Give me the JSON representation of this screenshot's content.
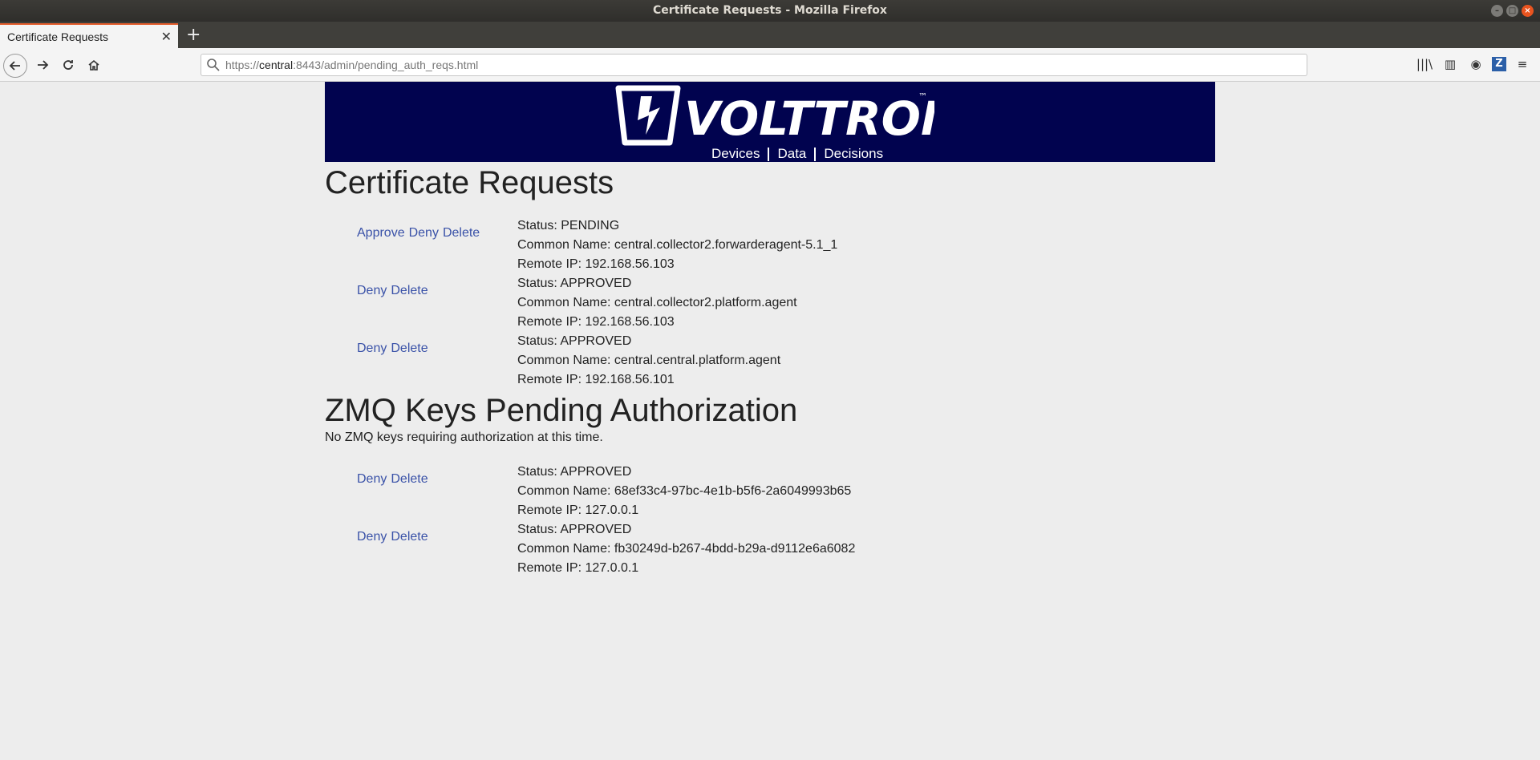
{
  "window": {
    "title": "Certificate Requests - Mozilla Firefox"
  },
  "tab": {
    "label": "Certificate Requests",
    "close": "✕",
    "new": "+"
  },
  "nav": {
    "url_prefix": "https://",
    "url_host": "central",
    "url_rest": ":8443/admin/pending_auth_reqs.html"
  },
  "banner": {
    "logo_text": "VOLTTRON",
    "logo_tm": "™",
    "links": [
      "Devices",
      "Data",
      "Decisions"
    ]
  },
  "certificates": {
    "title": "Certificate Requests",
    "requests": [
      {
        "actions": [
          "Approve",
          "Deny",
          "Delete"
        ],
        "status": "Status: PENDING",
        "common_name": "Common Name: central.collector2.forwarderagent-5.1_1",
        "remote_ip": "Remote IP: 192.168.56.103"
      },
      {
        "actions": [
          "Deny",
          "Delete"
        ],
        "status": "Status: APPROVED",
        "common_name": "Common Name: central.collector2.platform.agent",
        "remote_ip": "Remote IP: 192.168.56.103"
      },
      {
        "actions": [
          "Deny",
          "Delete"
        ],
        "status": "Status: APPROVED",
        "common_name": "Common Name: central.central.platform.agent",
        "remote_ip": "Remote IP: 192.168.56.101"
      }
    ]
  },
  "zmq": {
    "title": "ZMQ Keys Pending Authorization",
    "note": "No ZMQ keys requiring authorization at this time.",
    "keys": [
      {
        "actions": [
          "Deny",
          "Delete"
        ],
        "status": "Status: APPROVED",
        "common_name": "Common Name: 68ef33c4-97bc-4e1b-b5f6-2a6049993b65",
        "remote_ip": "Remote IP: 127.0.0.1"
      },
      {
        "actions": [
          "Deny",
          "Delete"
        ],
        "status": "Status: APPROVED",
        "common_name": "Common Name: fb30249d-b267-4bdd-b29a-d9112e6a6082",
        "remote_ip": "Remote IP: 127.0.0.1"
      }
    ]
  }
}
